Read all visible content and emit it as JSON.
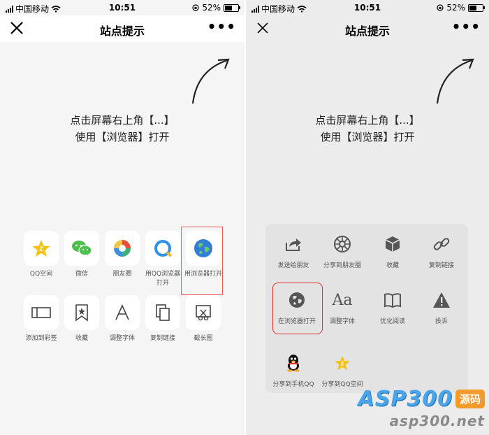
{
  "status": {
    "carrier": "中国移动",
    "time": "10:51",
    "battery": "52%"
  },
  "navbar": {
    "title": "站点提示"
  },
  "hint": {
    "line1": "点击屏幕右上角【...】",
    "line2": "使用【浏览器】打开"
  },
  "left_share": {
    "row1": [
      {
        "label": "QQ空间",
        "icon": "qzone-icon"
      },
      {
        "label": "微信",
        "icon": "wechat-icon"
      },
      {
        "label": "朋友圈",
        "icon": "moments-icon"
      },
      {
        "label": "用QQ浏览器打开",
        "icon": "qq-browser-icon"
      },
      {
        "label": "用浏览器打开",
        "icon": "globe-icon"
      }
    ],
    "row2": [
      {
        "label": "添加到彩签",
        "icon": "tag-icon"
      },
      {
        "label": "收藏",
        "icon": "bookmark-icon"
      },
      {
        "label": "调整字体",
        "icon": "font-icon"
      },
      {
        "label": "复制链接",
        "icon": "copy-icon"
      },
      {
        "label": "截长图",
        "icon": "screenshot-icon"
      }
    ]
  },
  "right_menu": {
    "row1": [
      "发送给朋友",
      "分享到朋友圈",
      "收藏",
      "复制链接"
    ],
    "row2": [
      "在浏览器打开",
      "调整字体",
      "优化阅读",
      "投诉"
    ],
    "row3": [
      "分享到手机QQ",
      "分享到QQ空间"
    ]
  },
  "watermark": {
    "brand": "ASP300",
    "badge": "源码",
    "url": "asp300.net"
  },
  "colors": {
    "highlight": "#e55555",
    "wechat_green": "#4cbf4c",
    "globe_blue": "#2f7fd6",
    "watermark_blue": "#4aa5e8",
    "watermark_orange": "#f39a2b"
  }
}
